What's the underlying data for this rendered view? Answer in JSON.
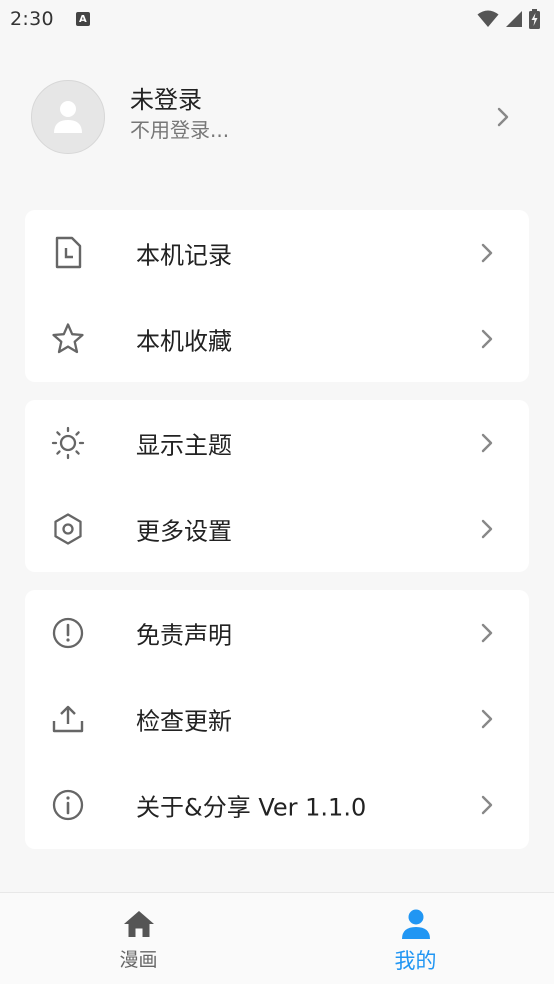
{
  "status_bar": {
    "time": "2:30",
    "notification_badge": "A"
  },
  "profile": {
    "name": "未登录",
    "subtitle": "不用登录..."
  },
  "groups": [
    {
      "items": [
        {
          "icon": "history-file-icon",
          "label": "本机记录"
        },
        {
          "icon": "star-icon",
          "label": "本机收藏"
        }
      ]
    },
    {
      "items": [
        {
          "icon": "sun-icon",
          "label": "显示主题"
        },
        {
          "icon": "hexagon-settings-icon",
          "label": "更多设置"
        }
      ]
    },
    {
      "items": [
        {
          "icon": "exclamation-circle-icon",
          "label": "免责声明"
        },
        {
          "icon": "upload-icon",
          "label": "检查更新"
        },
        {
          "icon": "info-circle-icon",
          "label": "关于&分享 Ver 1.1.0"
        }
      ]
    }
  ],
  "bottom_nav": {
    "items": [
      {
        "label": "漫画",
        "icon": "home-icon",
        "active": false
      },
      {
        "label": "我的",
        "icon": "person-icon",
        "active": true
      }
    ]
  },
  "colors": {
    "accent": "#2196f3",
    "icon_gray": "#666666",
    "background": "#f7f7f7",
    "card": "#ffffff"
  }
}
